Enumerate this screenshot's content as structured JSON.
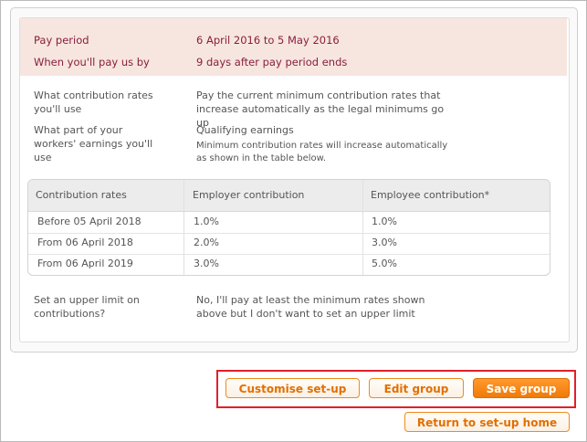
{
  "summary": {
    "pay_period_label": "Pay period",
    "pay_period_value": "6 April 2016 to 5 May 2016",
    "pay_us_label": "When you'll pay us by",
    "pay_us_value": "9 days after pay period ends"
  },
  "settings": {
    "contribution_rates_label": "What contribution rates you'll use",
    "contribution_rates_value": "Pay the current minimum contribution rates that increase automatically as the legal minimums go up",
    "earnings_label": "What part of your workers' earnings you'll use",
    "earnings_value": "Qualifying earnings",
    "earnings_note": "Minimum contribution rates will increase automatically as shown in the table below.",
    "upper_limit_label": "Set an upper limit on contributions?",
    "upper_limit_value": "No, I'll pay at least the minimum rates shown above but I don't want to set an upper limit"
  },
  "table": {
    "headers": [
      "Contribution rates",
      "Employer contribution",
      "Employee contribution*"
    ],
    "rows": [
      {
        "period": "Before 05 April 2018",
        "employer": "1.0%",
        "employee": "1.0%"
      },
      {
        "period": "From 06 April 2018",
        "employer": "2.0%",
        "employee": "3.0%"
      },
      {
        "period": "From 06 April 2019",
        "employer": "3.0%",
        "employee": "5.0%"
      }
    ]
  },
  "actions": {
    "customise": "Customise set-up",
    "edit": "Edit group",
    "save": "Save group",
    "return": "Return to set-up home"
  },
  "colors": {
    "accent": "#f07a08",
    "highlight": "#e0202a",
    "summary_bg": "#f7e6e0",
    "summary_text": "#8a1e3c"
  }
}
